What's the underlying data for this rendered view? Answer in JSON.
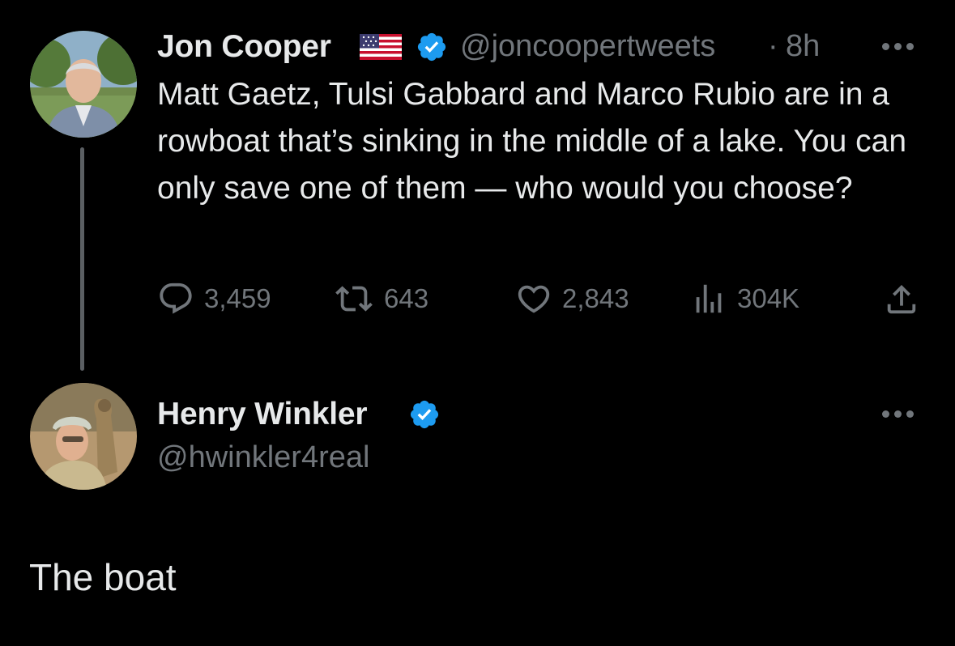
{
  "tweet": {
    "author_name": "Jon Cooper",
    "author_flag": "flag-us-icon",
    "author_verified": true,
    "author_handle": "@joncoopertweets",
    "separator": "·",
    "time": "8h",
    "text": "Matt Gaetz, Tulsi Gabbard and Marco Rubio are in a rowboat that’s sinking in the middle of a lake. You can only save one of them — who would you choose?",
    "stats": {
      "replies": "3,459",
      "reposts": "643",
      "likes": "2,843",
      "views": "304K"
    }
  },
  "reply": {
    "author_name": "Henry Winkler",
    "author_verified": true,
    "author_handle": "@hwinkler4real",
    "text": "The boat"
  },
  "colors": {
    "background": "#000000",
    "text": "#e7e9ea",
    "muted": "#71767b",
    "verified": "#1d9bf0",
    "thread_line": "#5b5f63"
  },
  "icons": [
    "more-icon",
    "verified-badge-icon",
    "reply-icon",
    "repost-icon",
    "like-icon",
    "views-icon",
    "share-icon",
    "flag-us-icon"
  ]
}
